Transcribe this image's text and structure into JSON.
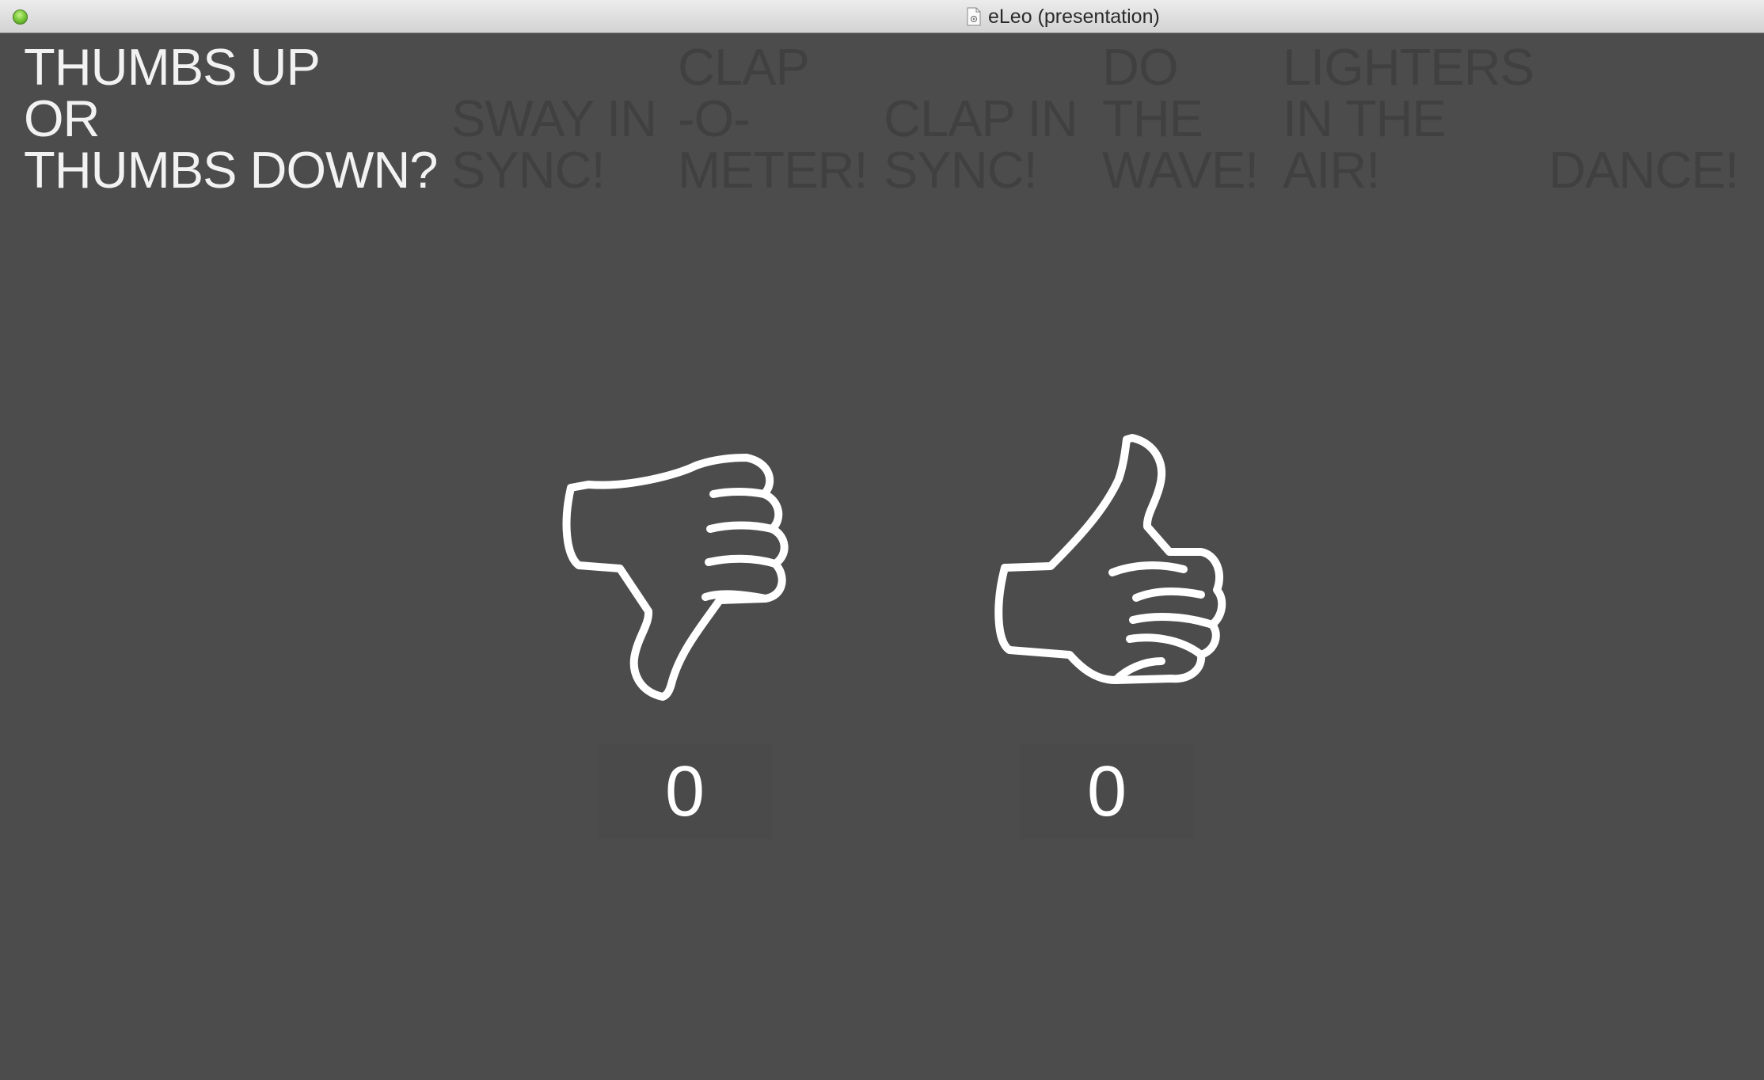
{
  "window": {
    "title": "eLeo (presentation)"
  },
  "menu": {
    "items": [
      {
        "label": "THUMBS UP\nOR\nTHUMBS DOWN?",
        "active": true
      },
      {
        "label": "\nSWAY IN\nSYNC!",
        "active": false
      },
      {
        "label": "CLAP\n-O-\nMETER!",
        "active": false
      },
      {
        "label": "\nCLAP IN\nSYNC!",
        "active": false
      },
      {
        "label": "DO\nTHE\nWAVE!",
        "active": false
      },
      {
        "label": "LIGHTERS\nIN THE\nAIR!",
        "active": false
      },
      {
        "label": "\n\nDANCE!",
        "active": false
      }
    ]
  },
  "voting": {
    "thumbs_down": {
      "icon": "thumbs-down-icon",
      "count": "0"
    },
    "thumbs_up": {
      "icon": "thumbs-up-icon",
      "count": "0"
    }
  },
  "colors": {
    "background": "#4c4c4c",
    "active_text": "#f2f2f2",
    "inactive_text": "#404040"
  }
}
